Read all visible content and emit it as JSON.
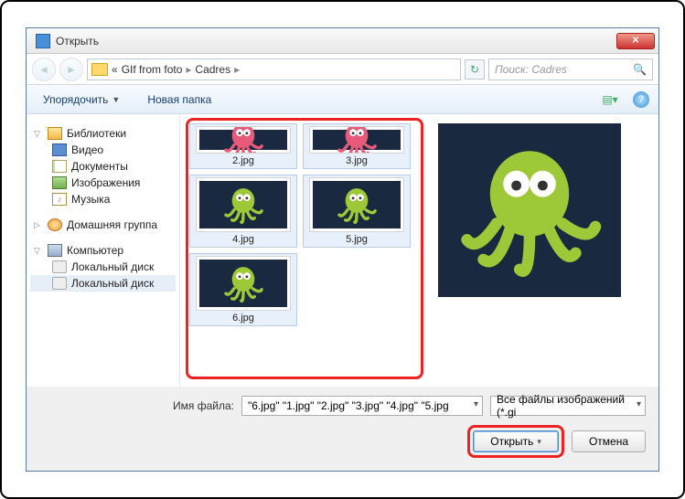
{
  "window": {
    "title": "Открыть"
  },
  "nav": {
    "path_segments": [
      "GIf from foto",
      "Cadres"
    ],
    "search_placeholder": "Поиск: Cadres"
  },
  "toolbar": {
    "organize": "Упорядочить",
    "new_folder": "Новая папка"
  },
  "sidebar": {
    "libraries": {
      "label": "Библиотеки",
      "items": [
        {
          "label": "Видео",
          "icon": "vid"
        },
        {
          "label": "Документы",
          "icon": "doc"
        },
        {
          "label": "Изображения",
          "icon": "img"
        },
        {
          "label": "Музыка",
          "icon": "mus"
        }
      ]
    },
    "homegroup": {
      "label": "Домашняя группа"
    },
    "computer": {
      "label": "Компьютер",
      "items": [
        {
          "label": "Локальный диск"
        },
        {
          "label": "Локальный диск"
        }
      ]
    }
  },
  "files": [
    {
      "name": "2.jpg",
      "variant": "pink",
      "half": true
    },
    {
      "name": "3.jpg",
      "variant": "pink",
      "half": true
    },
    {
      "name": "4.jpg",
      "variant": "green"
    },
    {
      "name": "5.jpg",
      "variant": "green"
    },
    {
      "name": "6.jpg",
      "variant": "green"
    }
  ],
  "footer": {
    "filename_label": "Имя файла:",
    "filename_value": "\"6.jpg\" \"1.jpg\" \"2.jpg\" \"3.jpg\" \"4.jpg\" \"5.jpg",
    "filter_value": "Все файлы изображений (*.gi",
    "open": "Открыть",
    "cancel": "Отмена"
  }
}
